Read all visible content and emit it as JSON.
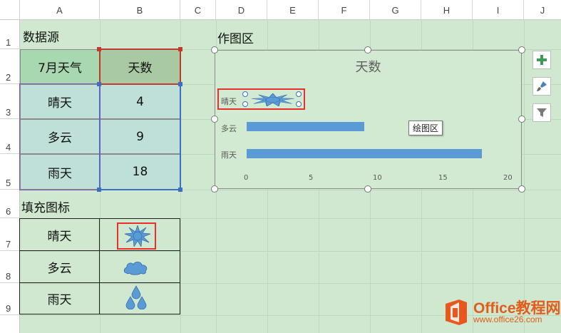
{
  "columns": [
    "A",
    "B",
    "C",
    "D",
    "E",
    "F",
    "G",
    "H",
    "I",
    "J"
  ],
  "rows": [
    "1",
    "2",
    "3",
    "4",
    "5",
    "6",
    "7",
    "8",
    "9"
  ],
  "section1_title": "数据源",
  "table1": {
    "headers": [
      "7月天气",
      "天数"
    ],
    "rows": [
      {
        "label": "晴天",
        "value": "4"
      },
      {
        "label": "多云",
        "value": "9"
      },
      {
        "label": "雨天",
        "value": "18"
      }
    ]
  },
  "section2_title": "填充图标",
  "table2": {
    "rows": [
      {
        "label": "晴天",
        "icon": "sun-icon"
      },
      {
        "label": "多云",
        "icon": "cloud-icon"
      },
      {
        "label": "雨天",
        "icon": "raindrops-icon"
      }
    ]
  },
  "chart_area_title": "作图区",
  "tooltip": "绘图区",
  "logo": {
    "main": "Office教程网",
    "sub": "www.office26.com"
  },
  "colors": {
    "bar": "#5b9bd5",
    "highlight": "#e8312a",
    "background": "#cfe8cf"
  },
  "chart_data": {
    "type": "bar",
    "orientation": "horizontal",
    "title": "天数",
    "categories": [
      "晴天",
      "多云",
      "雨天"
    ],
    "values": [
      4,
      9,
      18
    ],
    "xlim": [
      0,
      20
    ],
    "ticks": [
      "0",
      "5",
      "10",
      "15",
      "20"
    ],
    "grid": false,
    "legend": "none",
    "first_bar_fill": "sun-icon"
  }
}
